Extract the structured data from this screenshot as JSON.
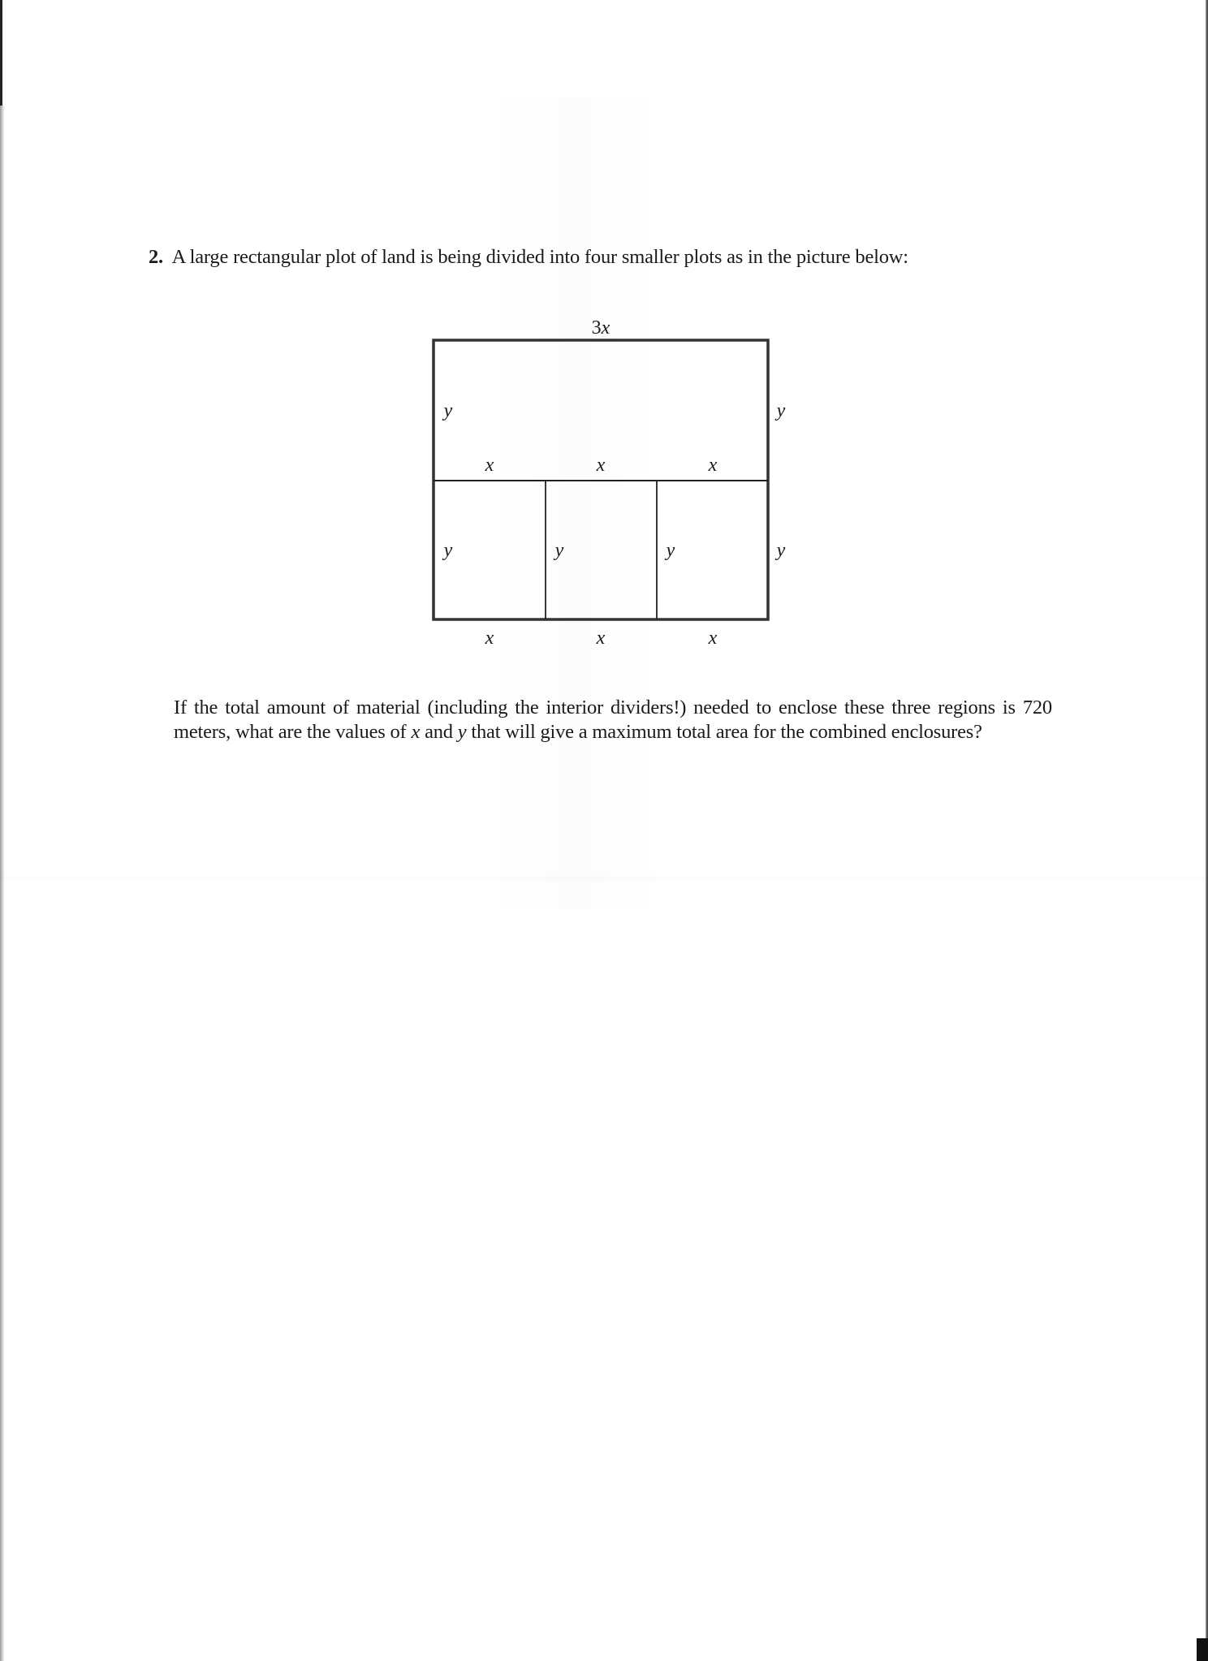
{
  "problem": {
    "number": "2.",
    "intro": "A large rectangular plot of land is being divided into four smaller plots as in the picture below:"
  },
  "diagram": {
    "top_label_coef": "3",
    "top_label_var": "x",
    "upper_region": {
      "left_label": "y",
      "right_label": "y",
      "bottom_labels": [
        "x",
        "x",
        "x"
      ]
    },
    "lower_regions": {
      "side_labels": [
        "y",
        "y",
        "y",
        "y"
      ],
      "bottom_labels": [
        "x",
        "x",
        "x"
      ]
    }
  },
  "question": {
    "part1": "If the total amount of material (including the interior dividers!) needed to enclose these three regions is 720 meters, what are the values of ",
    "var_x": "x",
    "part2": " and ",
    "var_y": "y",
    "part3": " that will give a maximum total area for the combined enclosures?"
  },
  "colors": {
    "ink": "#1a1a1a",
    "paper": "#ffffff",
    "diagram_line": "#333333"
  }
}
